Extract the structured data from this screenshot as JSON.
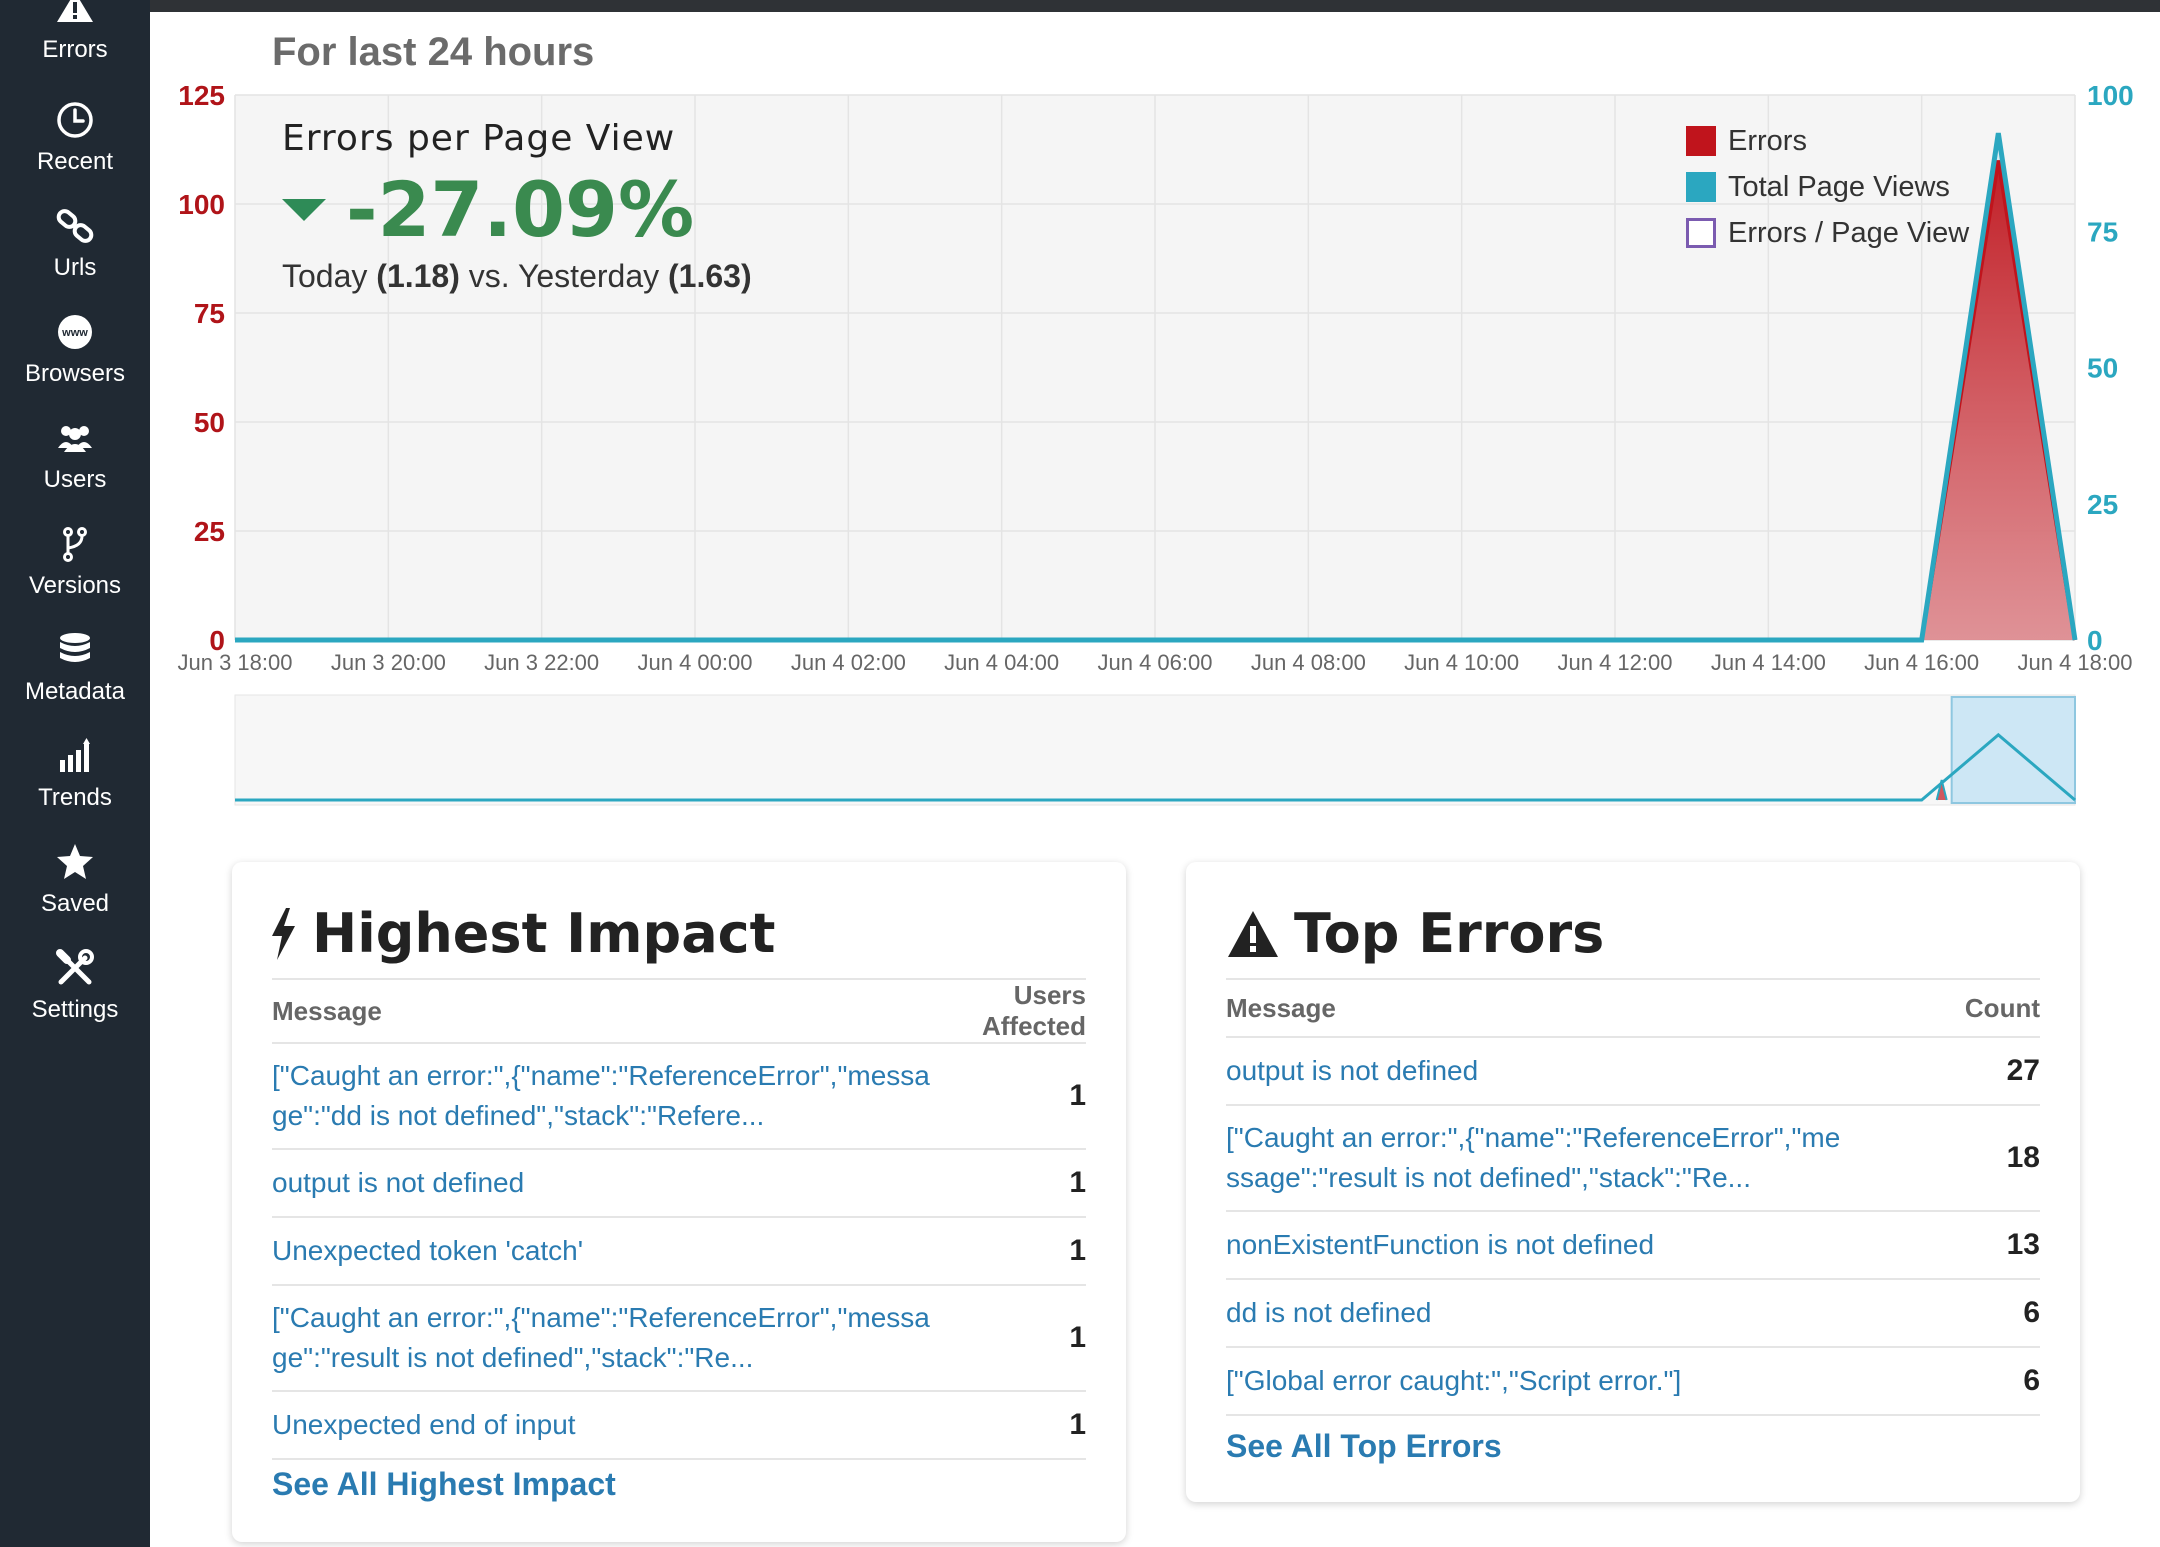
{
  "sidebar": {
    "items": [
      {
        "label": "Errors",
        "icon": "warning-icon"
      },
      {
        "label": "Recent",
        "icon": "clock-icon"
      },
      {
        "label": "Urls",
        "icon": "link-icon"
      },
      {
        "label": "Browsers",
        "icon": "globe-www-icon"
      },
      {
        "label": "Users",
        "icon": "users-icon"
      },
      {
        "label": "Versions",
        "icon": "branch-icon"
      },
      {
        "label": "Metadata",
        "icon": "database-icon"
      },
      {
        "label": "Trends",
        "icon": "trend-bars-icon"
      },
      {
        "label": "Saved",
        "icon": "star-icon"
      },
      {
        "label": "Settings",
        "icon": "tools-icon"
      }
    ]
  },
  "header": {
    "title": "For last 24 hours"
  },
  "kpi": {
    "title": "Errors per Page View",
    "change": "-27.09%",
    "today_label": "Today",
    "today_value": "(1.18)",
    "vs": "vs. Yesterday",
    "yesterday_value": "(1.63)",
    "change_color": "#3a8a4f"
  },
  "chart_data": {
    "type": "area",
    "x": [
      "Jun 3 18:00",
      "Jun 3 20:00",
      "Jun 3 22:00",
      "Jun 4 00:00",
      "Jun 4 02:00",
      "Jun 4 04:00",
      "Jun 4 06:00",
      "Jun 4 08:00",
      "Jun 4 10:00",
      "Jun 4 12:00",
      "Jun 4 14:00",
      "Jun 4 16:00",
      "Jun 4 17:00",
      "Jun 4 18:00"
    ],
    "x_tick_labels": [
      "Jun 3 18:00",
      "Jun 3 20:00",
      "Jun 3 22:00",
      "Jun 4 00:00",
      "Jun 4 02:00",
      "Jun 4 04:00",
      "Jun 4 06:00",
      "Jun 4 08:00",
      "Jun 4 10:00",
      "Jun 4 12:00",
      "Jun 4 14:00",
      "Jun 4 16:00",
      "Jun 4 18:00"
    ],
    "series": [
      {
        "name": "Errors",
        "axis": "left",
        "color": "#c0141c",
        "values": [
          0,
          0,
          0,
          0,
          0,
          0,
          0,
          0,
          0,
          0,
          0,
          0,
          110,
          0
        ]
      },
      {
        "name": "Total Page Views",
        "axis": "right",
        "color": "#2ba7c0",
        "values": [
          0,
          0,
          0,
          0,
          0,
          0,
          0,
          0,
          0,
          0,
          0,
          0,
          93,
          0
        ]
      },
      {
        "name": "Errors / Page View",
        "axis": "right",
        "color": "#7b5bb0",
        "values": []
      }
    ],
    "y_left": {
      "ticks": [
        "0",
        "25",
        "50",
        "75",
        "100",
        "125"
      ],
      "lim": [
        0,
        125
      ],
      "color": "#b01419"
    },
    "y_right": {
      "ticks": [
        "0",
        "25",
        "50",
        "75",
        "100"
      ],
      "lim": [
        0,
        100
      ],
      "color": "#2ba7c0"
    },
    "grid": true,
    "legend": "top-right",
    "navigator_range": [
      "Jun 4 16:00",
      "Jun 4 18:00"
    ]
  },
  "highest_impact": {
    "title": "Highest Impact",
    "col_message": "Message",
    "col_value": "Users Affected",
    "rows": [
      {
        "message": "[\"Caught an error:\",{\"name\":\"ReferenceError\",\"message\":\"dd is not defined\",\"stack\":\"Refere...",
        "value": "1"
      },
      {
        "message": "output is not defined",
        "value": "1"
      },
      {
        "message": "Unexpected token 'catch'",
        "value": "1"
      },
      {
        "message": "[\"Caught an error:\",{\"name\":\"ReferenceError\",\"message\":\"result is not defined\",\"stack\":\"Re...",
        "value": "1"
      },
      {
        "message": "Unexpected end of input",
        "value": "1"
      }
    ],
    "see_all": "See All Highest Impact"
  },
  "top_errors": {
    "title": "Top Errors",
    "col_message": "Message",
    "col_value": "Count",
    "rows": [
      {
        "message": "output is not defined",
        "value": "27"
      },
      {
        "message": "[\"Caught an error:\",{\"name\":\"ReferenceError\",\"message\":\"result is not defined\",\"stack\":\"Re...",
        "value": "18"
      },
      {
        "message": "nonExistentFunction is not defined",
        "value": "13"
      },
      {
        "message": "dd is not defined",
        "value": "6"
      },
      {
        "message": "[\"Global error caught:\",\"Script error.\"]",
        "value": "6"
      }
    ],
    "see_all": "See All Top Errors"
  }
}
